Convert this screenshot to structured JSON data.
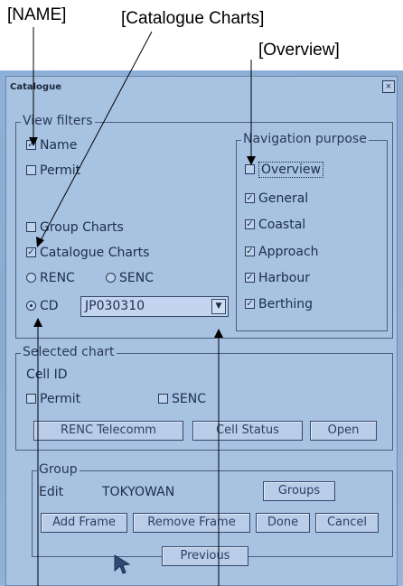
{
  "annotations": {
    "name": "[NAME]",
    "catalogue_charts": "[Catalogue Charts]",
    "overview": "[Overview]"
  },
  "window": {
    "title": "Catalogue",
    "close": "×"
  },
  "view_filters": {
    "label": "View filters",
    "name": {
      "label": "Name",
      "checked": true
    },
    "permit": {
      "label": "Permit",
      "checked": false
    },
    "group_charts": {
      "label": "Group Charts",
      "checked": false
    },
    "catalogue_charts": {
      "label": "Catalogue Charts",
      "checked": true
    },
    "renc": {
      "label": "RENC",
      "selected": false
    },
    "senc": {
      "label": "SENC",
      "selected": false
    },
    "cd": {
      "label": "CD",
      "selected": true
    },
    "cd_value": "JP030310"
  },
  "navigation_purpose": {
    "label": "Navigation purpose",
    "items": [
      {
        "label": "Overview",
        "checked": false
      },
      {
        "label": "General",
        "checked": true
      },
      {
        "label": "Coastal",
        "checked": true
      },
      {
        "label": "Approach",
        "checked": true
      },
      {
        "label": "Harbour",
        "checked": true
      },
      {
        "label": "Berthing",
        "checked": true
      }
    ]
  },
  "selected_chart": {
    "label": "Selected chart",
    "cell_id_label": "Cell ID",
    "permit": "Permit",
    "senc": "SENC",
    "buttons": {
      "renc_telecomm": "RENC Telecomm",
      "cell_status": "Cell Status",
      "open": "Open"
    }
  },
  "group": {
    "label": "Group",
    "edit_label": "Edit",
    "edit_value": "TOKYOWAN",
    "buttons": {
      "groups": "Groups",
      "add_frame": "Add Frame",
      "remove_frame": "Remove Frame",
      "done": "Done",
      "cancel": "Cancel"
    }
  },
  "previous": "Previous",
  "check_mark": "☑"
}
